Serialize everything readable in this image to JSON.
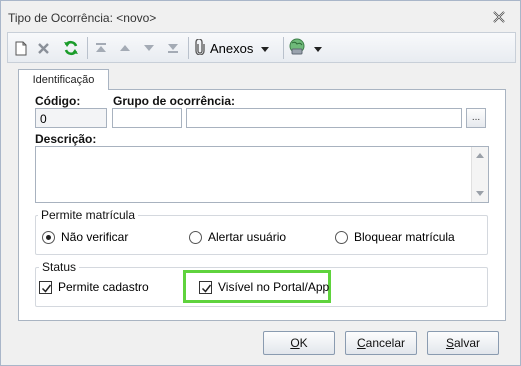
{
  "window": {
    "title": "Tipo de Ocorrência: <novo>"
  },
  "toolbar": {
    "anexos_label": "Anexos",
    "icons": [
      "new-document-icon",
      "delete-icon",
      "refresh-icon",
      "move-first-icon",
      "move-up-icon",
      "move-down-icon",
      "move-last-icon",
      "paperclip-icon",
      "chevron-down-icon",
      "globe-icon",
      "chevron-down-icon"
    ]
  },
  "tabs": [
    {
      "label": "Identificação",
      "active": true
    }
  ],
  "form": {
    "codigo_label": "Código:",
    "codigo_value": "0",
    "grupo_label": "Grupo de ocorrência:",
    "grupo_code_value": "",
    "grupo_name_value": "",
    "ellipsis_label": "...",
    "descricao_label": "Descrição:",
    "descricao_value": ""
  },
  "permite_matricula": {
    "title": "Permite matrícula",
    "options": [
      {
        "label": "Não verificar",
        "selected": true
      },
      {
        "label": "Alertar usuário",
        "selected": false
      },
      {
        "label": "Bloquear matrícula",
        "selected": false
      }
    ]
  },
  "status": {
    "title": "Status",
    "checks": [
      {
        "label": "Permite cadastro",
        "checked": true
      },
      {
        "label": "Visível no Portal/App",
        "checked": true
      }
    ]
  },
  "buttons": {
    "ok_first": "O",
    "ok_rest": "K",
    "cancel_first": "C",
    "cancel_rest": "ancelar",
    "save_first": "S",
    "save_rest": "alvar"
  },
  "colors": {
    "highlight": "#5fd33d",
    "refresh": "#1a9c2a"
  }
}
